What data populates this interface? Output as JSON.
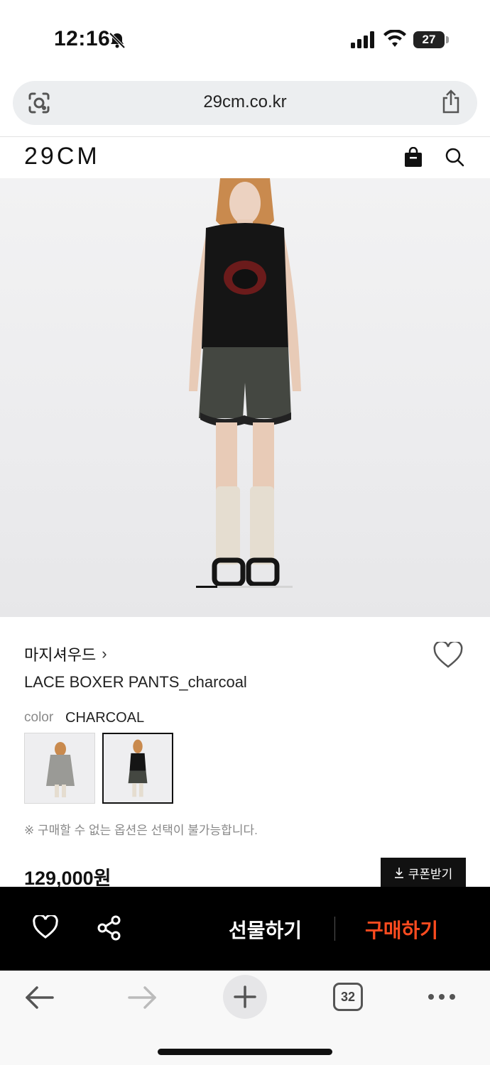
{
  "status_bar": {
    "time": "12:16",
    "battery": "27"
  },
  "browser": {
    "url": "29cm.co.kr",
    "tab_count": "32"
  },
  "header": {
    "logo": "29CM"
  },
  "product": {
    "brand": "마지셔우드",
    "brand_chevron": "›",
    "name": "LACE BOXER PANTS_charcoal",
    "color_label": "color",
    "color_value": "CHARCOAL",
    "notice": "※ 구매할 수 없는 옵션은 선택이 불가능합니다.",
    "price": "129,000원",
    "coupon_label": "쿠폰받기",
    "coupon_icon": "download-icon"
  },
  "carousel": {
    "active_index": 1
  },
  "buy_bar": {
    "gift_label": "선물하기",
    "buy_label": "구매하기"
  },
  "colors": {
    "accent": "#ff4b1f",
    "bar_bg": "#000000"
  }
}
